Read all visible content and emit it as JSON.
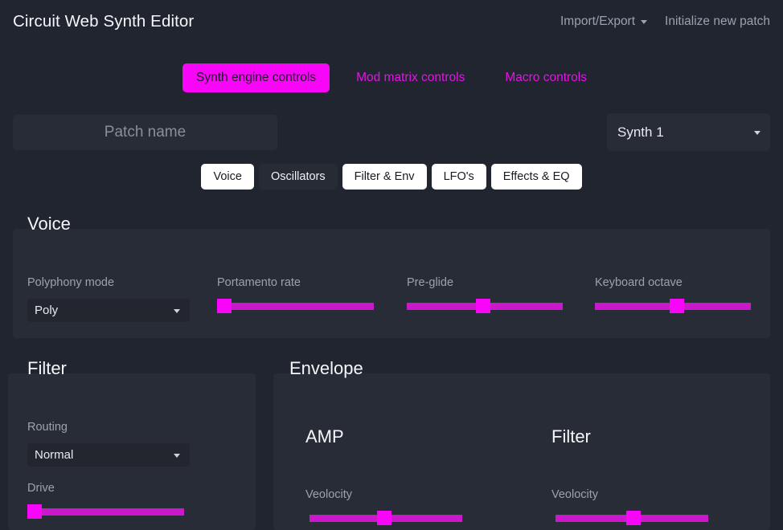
{
  "app": {
    "title": "Circuit Web Synth Editor",
    "accent_magenta": "#f806f8",
    "accent_magenta_track": "#cc18cc",
    "page_bg": "#212530",
    "panel_bg": "#282c36"
  },
  "topnav": {
    "import_export": "Import/Export",
    "initialize_new_patch": "Initialize new patch"
  },
  "main_tabs": [
    {
      "label": "Synth engine controls",
      "active": true
    },
    {
      "label": "Mod matrix controls",
      "active": false
    },
    {
      "label": "Macro controls",
      "active": false
    }
  ],
  "patch": {
    "name_value": "",
    "name_placeholder": "Patch name",
    "synth_selected": "Synth 1"
  },
  "sub_tabs": [
    {
      "label": "Voice",
      "style": "light"
    },
    {
      "label": "Oscillators",
      "style": "dark"
    },
    {
      "label": "Filter & Env",
      "style": "light"
    },
    {
      "label": "LFO's",
      "style": "light"
    },
    {
      "label": "Effects & EQ",
      "style": "light"
    }
  ],
  "voice": {
    "legend": "Voice",
    "polyphony_label": "Polyphony mode",
    "polyphony_value": "Poly",
    "portamento_label": "Portamento rate",
    "portamento_percent": 0,
    "preglide_label": "Pre-glide",
    "preglide_percent": 49,
    "keyboard_octave_label": "Keyboard octave",
    "keyboard_octave_percent": 53
  },
  "filter": {
    "legend": "Filter",
    "routing_label": "Routing",
    "routing_value": "Normal",
    "drive_label": "Drive",
    "drive_percent": 0
  },
  "envelope": {
    "legend": "Envelope",
    "amp_heading": "AMP",
    "amp_velocity_label": "Veolocity",
    "amp_velocity_percent": 49,
    "filter_heading": "Filter",
    "filter_velocity_label": "Veolocity",
    "filter_velocity_percent": 51
  }
}
